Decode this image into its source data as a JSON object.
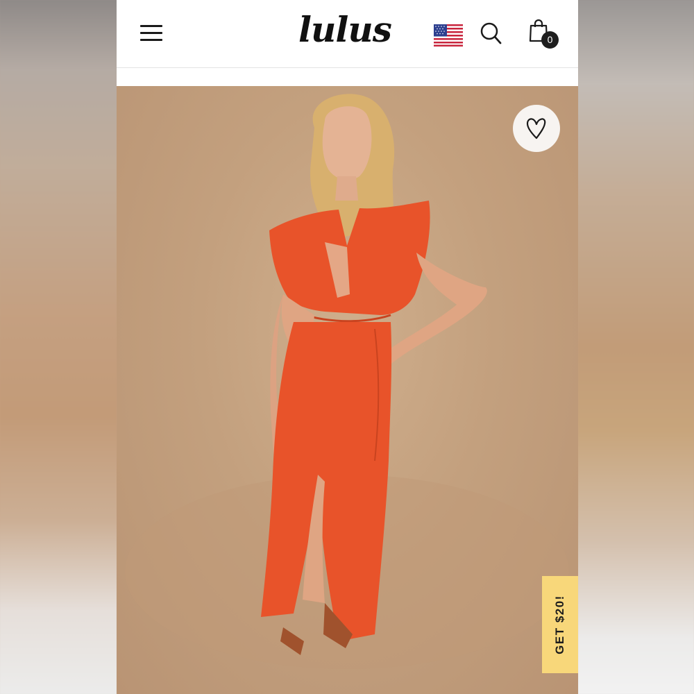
{
  "header": {
    "logo_text": "lulus",
    "menu_icon": "hamburger-menu-icon",
    "flag_icon": "us-flag-icon",
    "search_icon": "search-icon",
    "cart_icon": "shopping-bag-icon",
    "cart_count": "0"
  },
  "product": {
    "image_description_icon": "model-in-orange-two-piece-set",
    "wishlist_icon": "heart-icon",
    "promo_label": "GET $20!",
    "colors": {
      "outfit": "#e8532a",
      "background": "#c6a482",
      "promo": "#f8d77a"
    }
  }
}
